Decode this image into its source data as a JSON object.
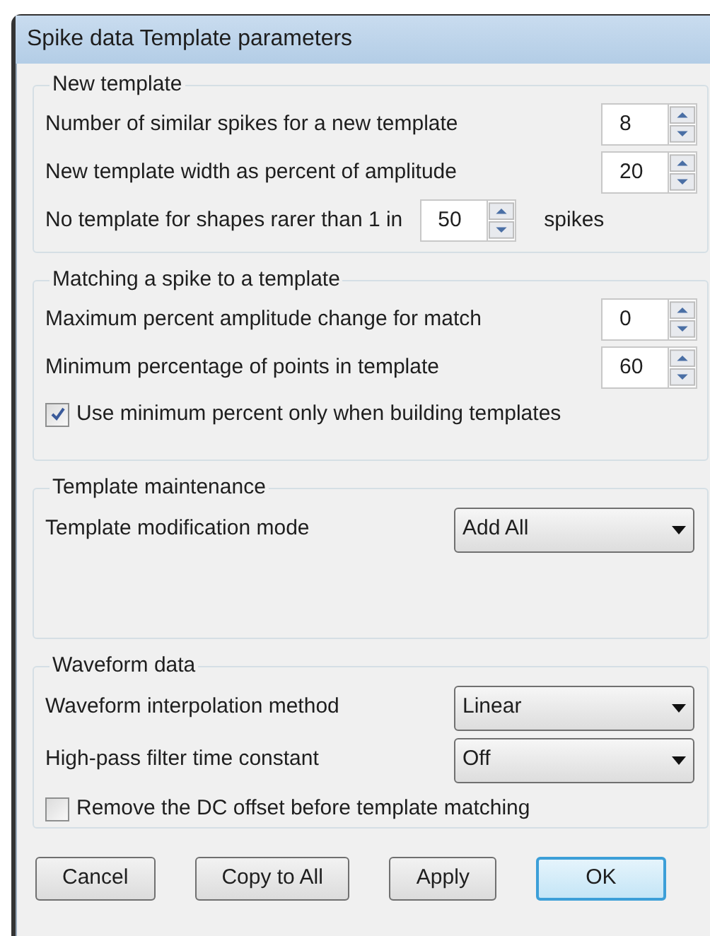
{
  "window": {
    "title": "Spike data Template parameters"
  },
  "groups": [
    {
      "title": "New template",
      "rows": [
        {
          "kind": "spin",
          "label": "Number of similar spikes for a new template",
          "value": "8"
        },
        {
          "kind": "spin",
          "label": "New template width as percent of amplitude",
          "value": "20"
        },
        {
          "kind": "spin_inline",
          "label": "No template for shapes rarer than 1 in",
          "value": "50",
          "suffix": "spikes"
        }
      ]
    },
    {
      "title": "Matching a spike to a template",
      "rows": [
        {
          "kind": "spin",
          "label": "Maximum percent amplitude change for match",
          "value": "0"
        },
        {
          "kind": "spin",
          "label": "Minimum percentage of points in template",
          "value": "60"
        },
        {
          "kind": "checkbox",
          "label": "Use minimum percent only when building templates",
          "checked": true
        }
      ]
    },
    {
      "title": "Template maintenance",
      "rows": [
        {
          "kind": "dropdown",
          "label": "Template modification mode",
          "value": "Add All"
        }
      ]
    },
    {
      "title": "Waveform data",
      "rows": [
        {
          "kind": "dropdown",
          "label": "Waveform interpolation method",
          "value": "Linear"
        },
        {
          "kind": "dropdown",
          "label": "High-pass filter time constant",
          "value": "Off"
        },
        {
          "kind": "checkbox",
          "label": "Remove the DC offset before template matching",
          "checked": false
        }
      ]
    }
  ],
  "buttons": [
    {
      "label": "Cancel",
      "default": false
    },
    {
      "label": "Copy to All",
      "default": false
    },
    {
      "label": "Apply",
      "default": false
    },
    {
      "label": "OK",
      "default": true
    }
  ]
}
